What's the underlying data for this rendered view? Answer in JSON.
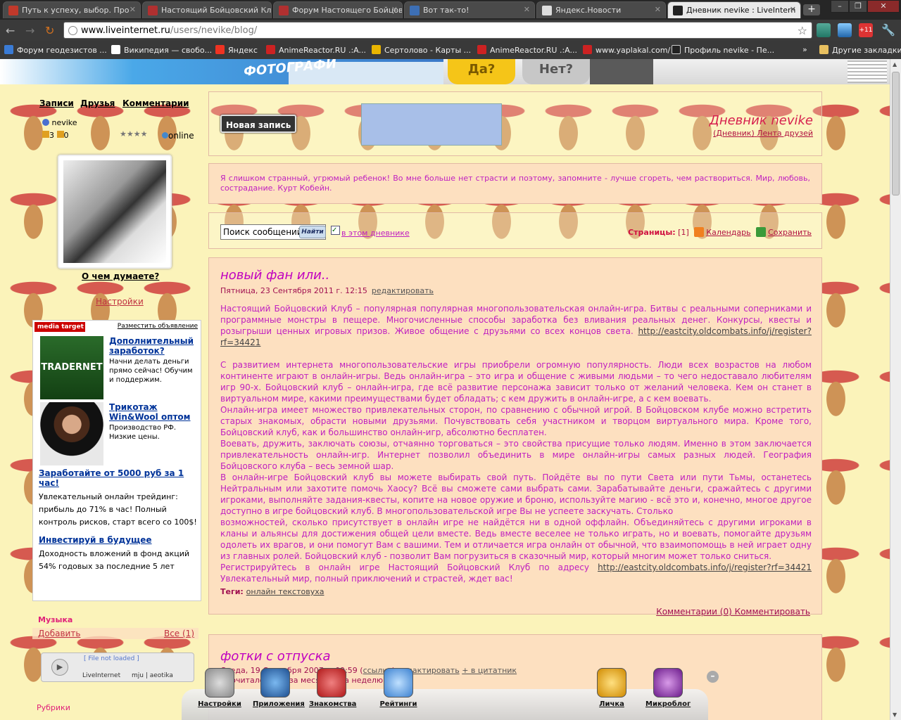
{
  "browser": {
    "tabs": [
      {
        "title": "Путь к успеху, выбор. Про",
        "color": "#c0392b"
      },
      {
        "title": "Настоящий Бойцовский Клу",
        "color": "#b03030"
      },
      {
        "title": "Форум Настоящего Бойцов",
        "color": "#b03030"
      },
      {
        "title": "Вот так-то!",
        "color": "#3d6fb5"
      },
      {
        "title": "Яндекс.Новости",
        "color": "#dddddd"
      },
      {
        "title": "Дневник nevike : LiveIntern",
        "color": "#222222"
      }
    ],
    "new_tab": "+",
    "window_buttons": [
      "–",
      "❐",
      "✕"
    ],
    "url_prefix": "www.liveinternet.ru",
    "url_path": "/users/nevike/blog/",
    "ext_badge": "+11",
    "bookmarks": [
      {
        "label": "Форум геодезистов ...",
        "color": "#3a7bd5"
      },
      {
        "label": "Википедия — свобо...",
        "color": "#ffffff"
      },
      {
        "label": "Яндекс",
        "color": "#e32"
      },
      {
        "label": "AnimeReactor.RU .:A...",
        "color": "#c22"
      },
      {
        "label": "Сертолово - Карты ...",
        "color": "#e8b400"
      },
      {
        "label": "AnimeReactor.RU .:A...",
        "color": "#c22"
      },
      {
        "label": "www.yaplakal.com/",
        "color": "#c22"
      },
      {
        "label": "Профиль nevike - Пе...",
        "color": "#222"
      }
    ],
    "bookmarks_more": "»",
    "other_bookmarks": "Другие закладки"
  },
  "banner": {
    "text": "ФОТОГРАФИ",
    "yes": "Да?",
    "no": "Нет?"
  },
  "sidebar": {
    "nav": [
      "Записи",
      "Друзья",
      "Комментарии"
    ],
    "username": "nevike",
    "status": "online",
    "counts": [
      "3",
      "0"
    ],
    "rating_stars": "★★★★",
    "think_link": "О чем думаете?",
    "settings_link": "Настройки",
    "ad": {
      "brand": "media target",
      "place_ad": "Разместить объявление",
      "traderImageText": "TRADERNET",
      "items": [
        {
          "title": "Дополнительный заработок?",
          "desc": "Начни делать деньги прямо сейчас! Обучим и поддержим."
        },
        {
          "title": "Трикотаж Win&Wool оптом",
          "desc": "Производство РФ. Низкие цены."
        }
      ],
      "wide": [
        {
          "title": "Заработайте от 5000 руб за 1 час!",
          "desc": "Увлекательный онлайн трейдинг: прибыль до 71% в час! Полный контроль рисков, старт всего со 100$!"
        },
        {
          "title": "Инвестируй в будущее",
          "desc": "Доходность вложений в фонд акций 54% годовых за последние 5 лет"
        }
      ]
    },
    "music": {
      "title": "Музыка",
      "add": "Добавить",
      "all": "Все (1)",
      "player_status": "[ File not loaded ]",
      "player_brand": "LiveInternet",
      "player_user": "mju | aeotika"
    },
    "bottom_label": "Рубрики"
  },
  "header": {
    "new_post": "Новая запись",
    "diary_title": "Дневник nevike",
    "diary_sub_1": "(Дневник)",
    "diary_sub_2": "Лента друзей"
  },
  "quote": "Я слишком странный, угрюмый ребенок! Во мне больше нет страсти и поэтому, запомните - лучше сгореть, чем раствориться. Мир, любовь, сострадание. Курт Кобейн.",
  "search": {
    "placeholder": "Поиск сообщений",
    "button": "Найти",
    "checkbox": "в этом дневнике",
    "checkbox_mark": "✓",
    "pages_label": "Страницы:",
    "pages_value": "[1]",
    "calendar": "Календарь",
    "save": "Сохранить"
  },
  "post1": {
    "title": "новый фан или..",
    "date": "Пятница, 23 Сентября 2011 г. 12:15",
    "edit": "редактировать",
    "p1": "Настоящий Бойцовский Клуб – популярная популярная многопользовательская онлайн-игра. Битвы с реальными соперниками и программные монстры в пещере. Многочисленные способы заработка без вливания реальных денег. Конкурсы, квесты и розыгрыши ценных игровых призов. Живое общение с друзьями со всех концов света.",
    "link": "http://eastcity.oldcombats.info/j/register?rf=34421",
    "p2": "С развитием интернета многопользовательские игры приобрели огромную популярность. Люди всех возрастов на любом континенте играют в онлайн-игры. Ведь онлайн-игра – это игра и общение с живыми людьми – то чего недоставало любителям игр 90-х. Бойцовский клуб – онлайн-игра, где всё развитие персонажа зависит только от желаний человека. Кем он станет в виртуальном мире, какими преимуществами будет обладать; с кем дружить в онлайн-игре, а с кем воевать.",
    "p3": "Онлайн-игра имеет множество привлекательных сторон, по сравнению с обычной игрой. В Бойцовском клубе можно встретить старых знакомых, обрасти новыми друзьями. Почувствовать себя участником и творцом виртуального мира. Кроме того, Бойцовский клуб, как и большинство онлайн-игр, абсолютно бесплатен.",
    "p4": "Воевать, дружить, заключать союзы, отчаянно торговаться – это свойства присущие только людям. Именно в этом заключается привлекательность онлайн-игр. Интернет позволил объединить в мире онлайн-игры самых разных людей. География Бойцовского клуба – весь земной шар.",
    "p5": "В онлайн-игре Бойцовский клуб вы можете выбирать свой путь. Пойдёте вы по пути Света или пути Тьмы, останетесь Нейтральным или захотите помочь Хаосу? Всё вы сможете сами выбрать сами. Зарабатывайте деньги, сражайтесь с другими игроками, выполняйте задания-квесты, копите на новое оружие и броню, используйте магию - всё это и, конечно, многое другое доступно в игре бойцовский клуб. В многопользовательской игре Вы не успеете заскучать. Столько",
    "p6": "возможностей, сколько присутствует в онлайн игре не найдётся ни в одной оффлайн. Объединяйтесь с другими игроками в кланы и альянсы для достижения общей цели вместе. Ведь вместе веселее не только играть, но и воевать, помогайте друзьям одолеть их врагов, и они помогут Вам с вашими. Тем и отличается игра онлайн от обычной, что взаимопомощь в ней играет одну из главных ролей. Бойцовский клуб - позволит Вам погрузиться в сказочный мир, который многим может только сниться.",
    "p7a": "Регистрируйтесь в онлайн игре Настоящий Бойцовский Клуб по адресу",
    "p7b": "Увлекательный мир, полный приключений и страстей, ждет вас!",
    "tags_label": "Теги:",
    "tag": "онлайн текстовуха",
    "comments": "Комментарии (0) Комментировать"
  },
  "post2": {
    "title": "фотки с отпуска",
    "date": "Среда, 19 Сентября 2007 г. 09:59 (",
    "date_link": "ссылка",
    "date_close": ")",
    "edit": "редактировать",
    "quote_btn": "+ в цитатник",
    "meta": "Прочитало: 1 / 1 за месяц / 2 за неделю"
  },
  "dock": [
    {
      "label": "Настройки",
      "color": "#999999"
    },
    {
      "label": "Приложения",
      "color": "#2e6fb8"
    },
    {
      "label": "Знакомства",
      "color": "#d83a3a"
    },
    {
      "label": "Рейтинги",
      "color": "#5aa0e8"
    },
    {
      "label": "Личка",
      "color": "#e8a812"
    },
    {
      "label": "Микроблог",
      "color": "#9b3fb5"
    }
  ],
  "dock_min": "–"
}
